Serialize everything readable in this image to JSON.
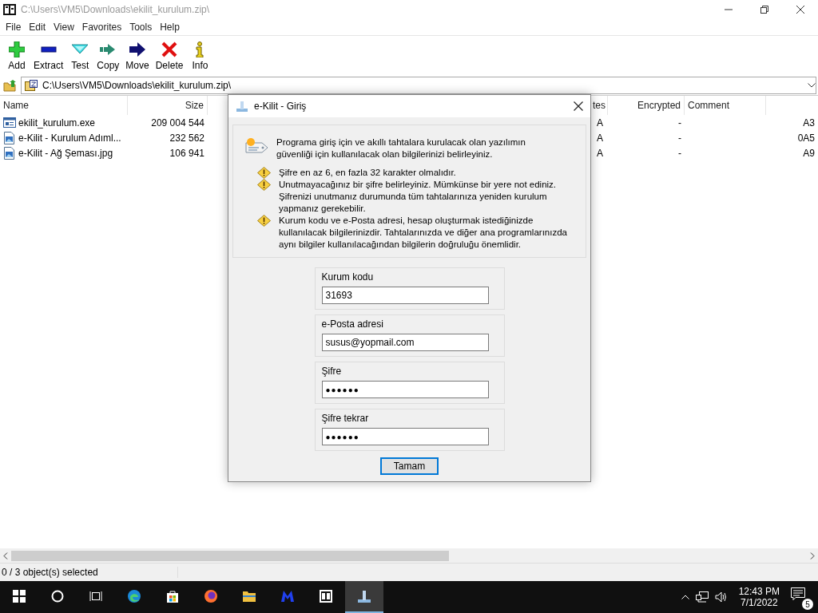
{
  "window": {
    "title": "C:\\Users\\VM5\\Downloads\\ekilit_kurulum.zip\\"
  },
  "menu": [
    "File",
    "Edit",
    "View",
    "Favorites",
    "Tools",
    "Help"
  ],
  "toolbar": [
    {
      "label": "Add",
      "kind": "add"
    },
    {
      "label": "Extract",
      "kind": "extract"
    },
    {
      "label": "Test",
      "kind": "test"
    },
    {
      "label": "Copy",
      "kind": "copy"
    },
    {
      "label": "Move",
      "kind": "move"
    },
    {
      "label": "Delete",
      "kind": "delete"
    },
    {
      "label": "Info",
      "kind": "info"
    }
  ],
  "address": {
    "value": "C:\\Users\\VM5\\Downloads\\ekilit_kurulum.zip\\"
  },
  "file_list": {
    "columns": [
      "Name",
      "Size",
      "tes",
      "Encrypted",
      "Comment"
    ],
    "rows": [
      {
        "kind": "exe",
        "name": "ekilit_kurulum.exe",
        "size": "209 004 544",
        "attributes": "A",
        "encrypted": "-",
        "column_6": "A3"
      },
      {
        "kind": "image",
        "name": "e-Kilit - Kurulum Adıml...",
        "size": "232 562",
        "attributes": "A",
        "encrypted": "-",
        "column_6": "0A5"
      },
      {
        "kind": "image",
        "name": "e-Kilit - Ağ Şeması.jpg",
        "size": "106 941",
        "attributes": "A",
        "encrypted": "-",
        "column_6": "A9"
      }
    ]
  },
  "status_bar": {
    "text": "0 / 3 object(s) selected"
  },
  "dialog": {
    "title": "e-Kilit - Giriş",
    "intro": "Programa giriş için ve akıllı tahtalara kurulacak olan yazılımın güvenliği için kullanılacak olan bilgilerinizi belirleyiniz.",
    "notes": [
      "Şifre en az 6, en fazla 32 karakter olmalıdır.",
      "Unutmayacağınız bir şifre belirleyiniz. Mümkünse bir yere not ediniz. Şifrenizi unutmanız durumunda tüm tahtalarınıza yeniden kurulum yapmanız gerekebilir.",
      "Kurum kodu ve e-Posta adresi, hesap oluşturmak istediğinizde kullanılacak bilgilerinizdir. Tahtalarınızda ve diğer ana programlarınızda aynı bilgiler kullanılacağından bilgilerin doğruluğu önemlidir."
    ],
    "fields": [
      {
        "label": "Kurum kodu",
        "value": "31693",
        "kind": "text"
      },
      {
        "label": "e-Posta adresi",
        "value": "susus@yopmail.com",
        "kind": "text"
      },
      {
        "label": "Şifre",
        "value": "●●●●●●",
        "kind": "password"
      },
      {
        "label": "Şifre tekrar",
        "value": "●●●●●●",
        "kind": "password"
      }
    ],
    "button": "Tamam"
  },
  "taskbar": {
    "apps": [
      {
        "kind": "start",
        "selected": false
      },
      {
        "kind": "search",
        "selected": false
      },
      {
        "kind": "taskview",
        "selected": false
      },
      {
        "kind": "edge",
        "selected": false
      },
      {
        "kind": "store",
        "selected": false
      },
      {
        "kind": "firefox",
        "selected": false
      },
      {
        "kind": "explorer",
        "selected": false
      },
      {
        "kind": "malware",
        "selected": false
      },
      {
        "kind": "sevenzip",
        "selected": false
      },
      {
        "kind": "ekilit",
        "selected": true
      }
    ],
    "time": "12:43 PM",
    "date": "7/1/2022",
    "notifications": "5"
  }
}
